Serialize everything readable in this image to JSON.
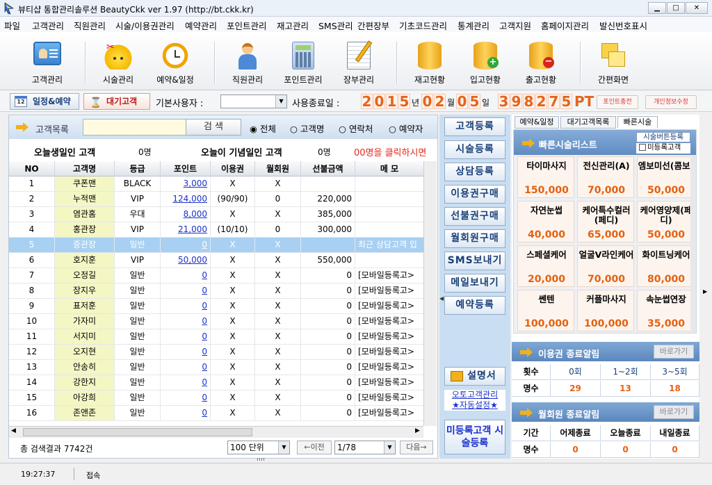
{
  "window": {
    "title": "뷰티샵 통합관리솔루션 BeautyCkk ver 1.97 (http://bt.ckk.kr)",
    "min": "▁",
    "max": "□",
    "close": "✕"
  },
  "menu": [
    "파일",
    "고객관리",
    "직원관리",
    "시술/이용권관리",
    "예약관리",
    "포인트관리",
    "재고관리",
    "SMS관리",
    "간편장부",
    "기초코드관리",
    "통계관리",
    "고객지원",
    "홈페이지관리",
    "발신번호표시"
  ],
  "toolbar": [
    {
      "label": "고객관리",
      "icon": "customer-card-icon"
    },
    {
      "label": "시술관리",
      "icon": "scissors-smiley-icon"
    },
    {
      "label": "예약&일정",
      "icon": "alarm-clock-icon"
    },
    {
      "label": "직원관리",
      "icon": "staff-person-icon"
    },
    {
      "label": "포인트관리",
      "icon": "calculator-icon"
    },
    {
      "label": "장부관리",
      "icon": "notepad-pencil-icon"
    },
    {
      "label": "재고현황",
      "icon": "database-icon"
    },
    {
      "label": "입고현황",
      "icon": "database-plus-icon"
    },
    {
      "label": "출고현황",
      "icon": "database-minus-icon"
    },
    {
      "label": "간편화면",
      "icon": "windows-icon"
    }
  ],
  "bar2": {
    "schedule_btn": "일정&예약",
    "waiting_btn": "대기고객",
    "default_user_label": "기본사용자 :",
    "default_user_value": "",
    "expire_label": "사용종료일 :",
    "year": [
      "2",
      "0",
      "1",
      "5"
    ],
    "year_unit": "년",
    "month": [
      "0",
      "2"
    ],
    "month_unit": "월",
    "day": [
      "0",
      "5"
    ],
    "day_unit": "일",
    "points": [
      "3",
      "9",
      "8",
      "2",
      "7",
      "5"
    ],
    "pt": "PT",
    "point_charge": "포인트충전",
    "privacy": "개인정보수정"
  },
  "search": {
    "label": "고객목록",
    "placeholder": "",
    "button": "검 색",
    "radios": [
      "전체",
      "고객명",
      "연락처",
      "예약자"
    ],
    "selected": 0
  },
  "notice": {
    "birthday": "오늘생일인 고객",
    "birthday_count": "0명",
    "anniv": "오늘이 기념일인 고객",
    "anniv_count": "0명",
    "click": "00명을 클릭하시면"
  },
  "grid": {
    "columns": [
      "NO",
      "고객명",
      "등급",
      "포인트",
      "이용권",
      "월회원",
      "선불금액",
      "메 모"
    ],
    "rows": [
      [
        "1",
        "쿠폰맨",
        "BLACK",
        "3,000",
        "X",
        "X",
        "",
        ""
      ],
      [
        "2",
        "누적맨",
        "VIP",
        "124,000",
        "(90/90)",
        "0",
        "220,000",
        ""
      ],
      [
        "3",
        "염관홈",
        "우대",
        "8,000",
        "X",
        "X",
        "385,000",
        ""
      ],
      [
        "4",
        "홍관장",
        "VIP",
        "21,000",
        "(10/10)",
        "0",
        "300,000",
        ""
      ],
      [
        "5",
        "중관장",
        "일반",
        "0",
        "X",
        "X",
        "",
        "최근 상담고객 입"
      ],
      [
        "6",
        "호지훈",
        "VIP",
        "50,000",
        "X",
        "X",
        "550,000",
        ""
      ],
      [
        "7",
        "오정길",
        "일반",
        "0",
        "X",
        "X",
        "0",
        "[모바일등록고>"
      ],
      [
        "8",
        "장지우",
        "일반",
        "0",
        "X",
        "X",
        "0",
        "[모바일등록고>"
      ],
      [
        "9",
        "표저훈",
        "일반",
        "0",
        "X",
        "X",
        "0",
        "[모바일등록고>"
      ],
      [
        "10",
        "가자미",
        "일반",
        "0",
        "X",
        "X",
        "0",
        "[모바일등록고>"
      ],
      [
        "11",
        "서지미",
        "일반",
        "0",
        "X",
        "X",
        "0",
        "[모바일등록고>"
      ],
      [
        "12",
        "오지현",
        "일반",
        "0",
        "X",
        "X",
        "0",
        "[모바일등록고>"
      ],
      [
        "13",
        "안송히",
        "일반",
        "0",
        "X",
        "X",
        "0",
        "[모바일등록고>"
      ],
      [
        "14",
        "강한지",
        "일반",
        "0",
        "X",
        "X",
        "0",
        "[모바일등록고>"
      ],
      [
        "15",
        "아강희",
        "일반",
        "0",
        "X",
        "X",
        "0",
        "[모바일등록고>"
      ],
      [
        "16",
        "존앤존",
        "일반",
        "0",
        "X",
        "X",
        "0",
        "[모바일등록고>"
      ]
    ],
    "selected_row": 4
  },
  "footer": {
    "total": "총 검색결과 7742건",
    "unit": "100 단위",
    "prev": "←이전",
    "page": "1/78",
    "next": "다음→"
  },
  "actions": [
    "고객등록",
    "시술등록",
    "상담등록",
    "이용권구매",
    "선불권구매",
    "월회원구매",
    "SMS보내기",
    "메일보내기",
    "예약등록"
  ],
  "manual": "설명서",
  "auto_link1": "오토고객관리",
  "auto_link2": "★자동설정★",
  "unreg_btn": "미등록고객 시술등록",
  "tabs": [
    "예약&일정",
    "대기고객목록",
    "빠른시술"
  ],
  "quick": {
    "title": "빠른시술리스트",
    "order_btn": "시술버튼등록",
    "unreg_check": "미등록고객",
    "items": [
      {
        "name": "타이마사지",
        "price": "150,000"
      },
      {
        "name": "전신관리(A)",
        "price": "70,000"
      },
      {
        "name": "엠보미선(콤보)",
        "price": "50,000"
      },
      {
        "name": "자연눈썹",
        "price": "40,000"
      },
      {
        "name": "케어특수컬러(페디)",
        "price": "65,000"
      },
      {
        "name": "케어영양제(페디)",
        "price": "50,000"
      },
      {
        "name": "스페셜케어",
        "price": "20,000"
      },
      {
        "name": "얼굴V라인케어",
        "price": "70,000"
      },
      {
        "name": "화이트닝케어",
        "price": "80,000"
      },
      {
        "name": "쎈텐",
        "price": "100,000"
      },
      {
        "name": "커플마사지",
        "price": "100,000"
      },
      {
        "name": "속눈썹연장",
        "price": "35,000"
      }
    ]
  },
  "ticket_alert": {
    "title": "이용권 종료알림",
    "btn": "바로가기",
    "headers": [
      "횟수",
      "0회",
      "1~2회",
      "3~5회"
    ],
    "row_label": "명수",
    "values": [
      "29",
      "13",
      "18"
    ]
  },
  "member_alert": {
    "title": "월회원 종료알림",
    "btn": "바로가기",
    "headers": [
      "기간",
      "어제종료",
      "오늘종료",
      "내일종료"
    ],
    "row_label": "명수",
    "values": [
      "0",
      "0",
      "0"
    ]
  },
  "status": {
    "time": "19:27:37",
    "state": "접속"
  }
}
